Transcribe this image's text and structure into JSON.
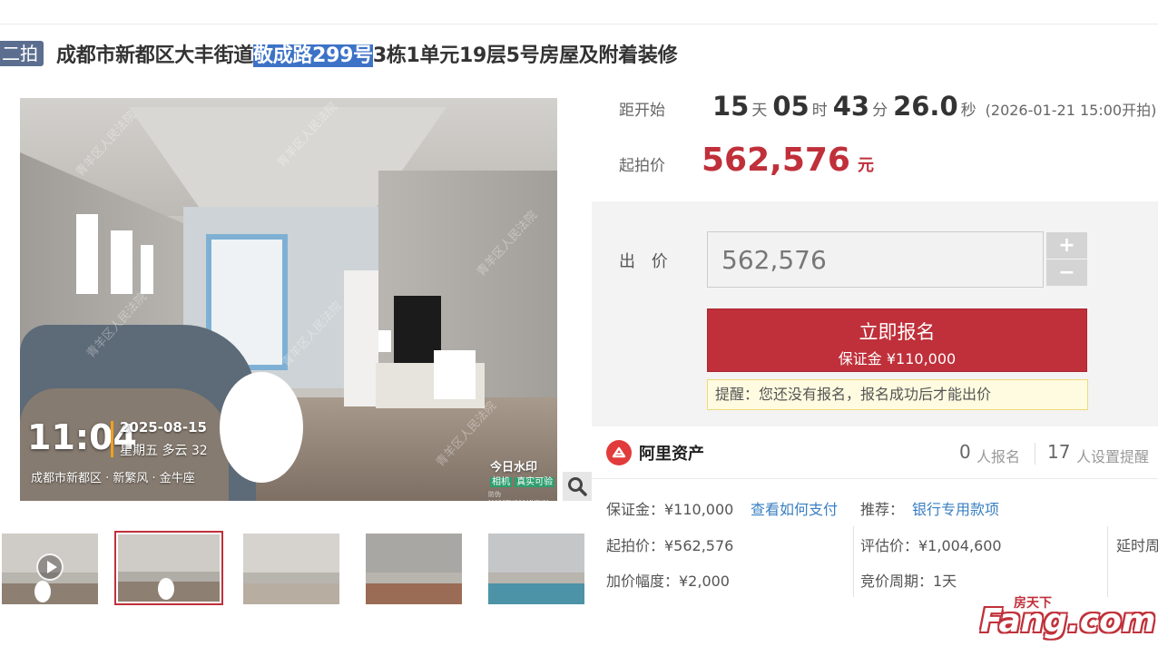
{
  "listing": {
    "round_tag": "二拍",
    "title_before": "成都市新都区大丰街道",
    "title_highlight": "敬成路299号",
    "title_after": "3栋1单元19层5号房屋及附着装修"
  },
  "photo": {
    "time": "11:04",
    "date": "2025-08-15",
    "weekday_weather": "星期五 多云 32",
    "location": "成都市新都区 · 新繁风 · 金牛座",
    "watermark_brand": "今日水印",
    "watermark_badge_left": "相机",
    "watermark_badge_right": "真实可验",
    "watermark_code": "防伪 M480TX291MYFYM",
    "court_watermark": "青羊区人民法院"
  },
  "countdown": {
    "label": "距开始",
    "days": "15",
    "days_unit": "天",
    "hours": "05",
    "hours_unit": "时",
    "minutes": "43",
    "minutes_unit": "分",
    "seconds": "26.0",
    "seconds_unit": "秒",
    "start_time": "(2026-01-21 15:00开拍)"
  },
  "start_price": {
    "label": "起拍价",
    "value": "562,576",
    "unit": "元"
  },
  "bid": {
    "label": "出 价",
    "input_value": "562,576",
    "plus": "+",
    "minus": "−",
    "signup_label": "立即报名",
    "deposit_line": "保证金 ¥110,000",
    "reminder": "提醒：您还没有报名，报名成功后才能出价"
  },
  "platform": {
    "name": "阿里资产",
    "signup_count": "0",
    "signup_label": "人报名",
    "reminder_count": "17",
    "reminder_label": "人设置提醒"
  },
  "details": {
    "deposit": "保证金：¥110,000",
    "how_to_pay": "查看如何支付",
    "recommend_label": "推荐：",
    "recommend_link": "银行专用款项",
    "start_price": "起拍价：¥562,576",
    "appraisal": "评估价：¥1,004,600",
    "delay": "延时周",
    "increment": "加价幅度：¥2,000",
    "cycle": "竞价周期：1天"
  },
  "site_logo": {
    "top": "房天下",
    "main": "Fang.com"
  },
  "colors": {
    "accent_red": "#c0303a",
    "link_blue": "#3a7fc1",
    "tag_blue": "#5b6e8f",
    "highlight_blue": "#3d73c7"
  }
}
